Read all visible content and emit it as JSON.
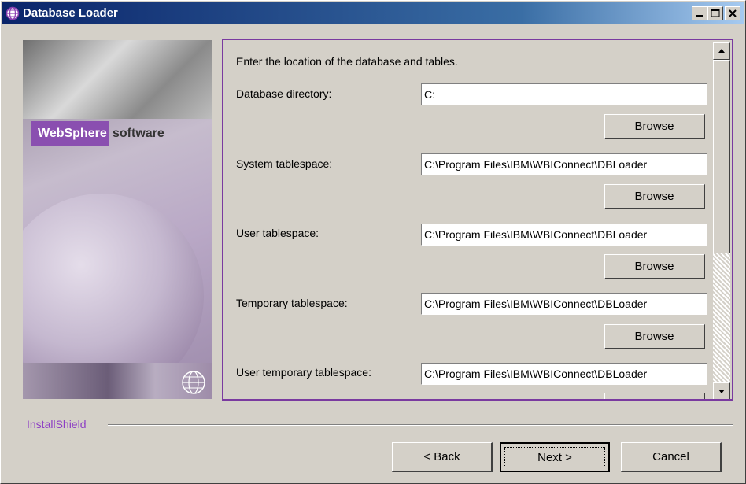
{
  "window": {
    "title": "Database Loader",
    "minimize_glyph": "_",
    "maximize_glyph": "□",
    "close_glyph": "×"
  },
  "banner": {
    "brand_name": "WebSphere",
    "brand_suffix": "software"
  },
  "form": {
    "prompt": "Enter the location of the database and tables.",
    "browse_label": "Browse",
    "fields": [
      {
        "label": "Database directory:",
        "value": "C:"
      },
      {
        "label": "System tablespace:",
        "value": "C:\\Program Files\\IBM\\WBIConnect\\DBLoader"
      },
      {
        "label": "User tablespace:",
        "value": "C:\\Program Files\\IBM\\WBIConnect\\DBLoader"
      },
      {
        "label": "Temporary tablespace:",
        "value": "C:\\Program Files\\IBM\\WBIConnect\\DBLoader"
      },
      {
        "label": "User temporary tablespace:",
        "value": "C:\\Program Files\\IBM\\WBIConnect\\DBLoader"
      }
    ]
  },
  "footer": {
    "installshield_label": "InstallShield",
    "back_label": "< Back",
    "next_label": "Next >",
    "cancel_label": "Cancel"
  },
  "colors": {
    "titlebar_start": "#0a246a",
    "panel_border": "#7a3aa0",
    "installshield_text": "#8c3cc4",
    "brand_box": "#8a4fb0"
  }
}
